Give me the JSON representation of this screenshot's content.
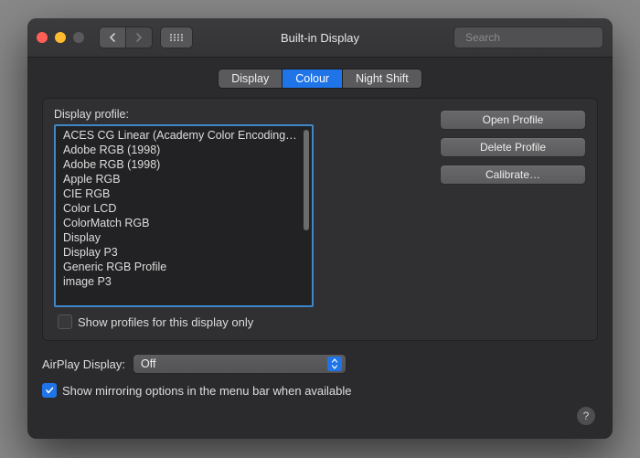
{
  "colors": {
    "close": "#ff5f57",
    "minimize": "#febc2e",
    "zoom": "#5a5a5c",
    "accent": "#1f74e8"
  },
  "titlebar": {
    "title": "Built-in Display",
    "search_placeholder": "Search"
  },
  "tabs": [
    {
      "label": "Display",
      "active": false
    },
    {
      "label": "Colour",
      "active": true
    },
    {
      "label": "Night Shift",
      "active": false
    }
  ],
  "profile": {
    "label": "Display profile:",
    "items": [
      "ACES CG Linear (Academy Color Encoding…",
      "Adobe RGB (1998)",
      "Adobe RGB (1998)",
      "Apple RGB",
      "CIE RGB",
      "Color LCD",
      "ColorMatch RGB",
      "Display",
      "Display P3",
      "Generic RGB Profile",
      "image P3"
    ]
  },
  "buttons": {
    "open": "Open Profile",
    "delete": "Delete Profile",
    "calibrate": "Calibrate…"
  },
  "show_only": {
    "checked": false,
    "label": "Show profiles for this display only"
  },
  "airplay": {
    "label": "AirPlay Display:",
    "value": "Off"
  },
  "mirror": {
    "checked": true,
    "label": "Show mirroring options in the menu bar when available"
  },
  "help_glyph": "?"
}
